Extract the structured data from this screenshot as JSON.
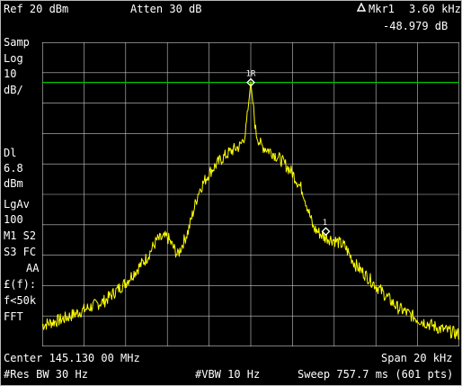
{
  "header": {
    "ref_level": "Ref 20 dBm",
    "attenuation": "Atten 30 dB",
    "marker_label": "Mkr1",
    "marker_freq": "3.60 kHz",
    "marker_value": "-48.979 dB"
  },
  "left_panel": {
    "detector": "Samp",
    "scale_type": "Log",
    "scale_value": "10",
    "scale_unit": "dB/",
    "display_line_label": "Dl",
    "display_line_value": "6.8",
    "display_line_unit": "dBm",
    "average_type": "LgAv",
    "average_count": "100",
    "trace_status_1": "M1  S2",
    "trace_status_2": "S3  FC",
    "trace_status_3": "AA",
    "correction_label": "£(f):",
    "freq_condition": "f<50k",
    "fft_label": "FFT"
  },
  "footer": {
    "center": "Center 145.130 00 MHz",
    "span": "Span 20 kHz",
    "res_bw": "#Res BW 30 Hz",
    "vbw": "#VBW 10 Hz",
    "sweep": "Sweep 757.7 ms (601 pts)"
  },
  "markers": {
    "ref_marker_label": "1R",
    "delta_marker_label": "1"
  },
  "colors": {
    "trace": "#ffff00",
    "display_line": "#00c800",
    "graticule": "#c8c8c8",
    "text": "#ffffff",
    "background": "#000000"
  },
  "chart_data": {
    "type": "line",
    "x_unit": "kHz offset from center",
    "y_unit": "dBm",
    "xlim": [
      -10,
      10
    ],
    "ylim": [
      -80,
      20
    ],
    "display_line_dbm": 6.8,
    "marker_ref": {
      "x": 0.0,
      "y": 6.8
    },
    "marker_delta": {
      "x": 3.6,
      "y": -42.2
    },
    "envelope": {
      "x": [
        -10,
        -9,
        -8,
        -7,
        -6,
        -5,
        -4.5,
        -4,
        -3.5,
        -3,
        -2.5,
        -2,
        -1.5,
        -1,
        -0.5,
        -0.25,
        0,
        0.25,
        0.5,
        1,
        1.5,
        2,
        2.5,
        3,
        3.5,
        4,
        4.5,
        5,
        6,
        7,
        8,
        9,
        10
      ],
      "y": [
        -73,
        -71,
        -68,
        -65,
        -59,
        -51,
        -45,
        -44,
        -50,
        -42,
        -29,
        -23,
        -19,
        -16,
        -14,
        -10,
        6.8,
        -10,
        -14,
        -16,
        -19,
        -23,
        -29,
        -41,
        -44,
        -45,
        -47,
        -53,
        -60,
        -67,
        -71,
        -74,
        -76
      ]
    }
  }
}
